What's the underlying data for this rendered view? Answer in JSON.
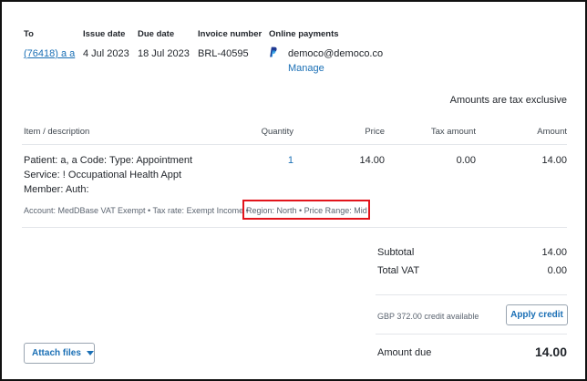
{
  "header": {
    "to_label": "To",
    "to_value": "(76418) a a",
    "issue_label": "Issue date",
    "issue_value": "4 Jul 2023",
    "due_label": "Due date",
    "due_value": "18 Jul 2023",
    "invoice_label": "Invoice number",
    "invoice_value": "BRL-40595",
    "payments_label": "Online payments",
    "payments_email": "democo@democo.co",
    "payments_manage": "Manage",
    "payments_icon": "paypal-icon"
  },
  "tax_note": "Amounts are tax exclusive",
  "table": {
    "columns": [
      "Item / description",
      "Quantity",
      "Price",
      "Tax amount",
      "Amount"
    ],
    "row": {
      "desc_line1": "Patient: a, a Code: Type: Appointment",
      "desc_line2": "Service: ! Occupational Health Appt",
      "desc_line3": "Member: Auth:",
      "quantity": "1",
      "price": "14.00",
      "tax_amount": "0.00",
      "amount": "14.00",
      "meta_left": "Account: MedDBase VAT Exempt • Tax rate: Exempt Income •",
      "meta_highlight": "Region: North • Price Range: Mid"
    }
  },
  "totals": {
    "subtotal_label": "Subtotal",
    "subtotal_value": "14.00",
    "vat_label": "Total VAT",
    "vat_value": "0.00",
    "credit_text": "GBP 372.00 credit available",
    "apply_credit": "Apply credit",
    "due_label": "Amount due",
    "due_value": "14.00"
  },
  "attach_files": "Attach files",
  "colors": {
    "link": "#1a6fb5",
    "highlight": "#e2141b",
    "paypal": "#1f3a93"
  }
}
